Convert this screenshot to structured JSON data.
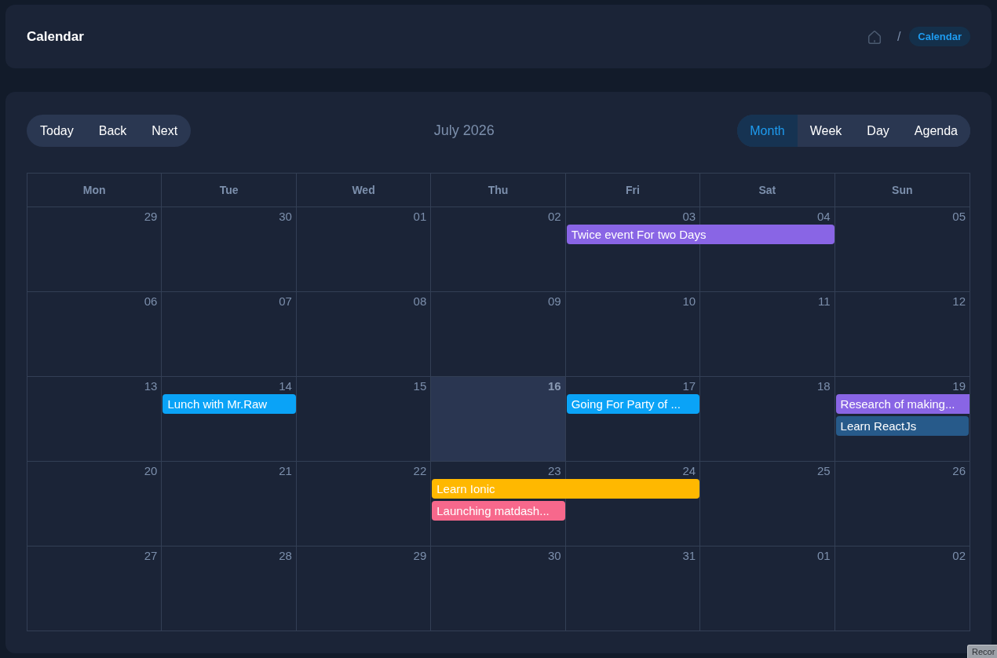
{
  "header": {
    "title": "Calendar",
    "breadcrumb": {
      "separator": "/",
      "current": "Calendar"
    }
  },
  "toolbar": {
    "nav_buttons": [
      "Today",
      "Back",
      "Next"
    ],
    "month_label": "July 2026",
    "views": [
      {
        "label": "Month",
        "selected": true
      },
      {
        "label": "Week",
        "selected": false
      },
      {
        "label": "Day",
        "selected": false
      },
      {
        "label": "Agenda",
        "selected": false
      }
    ]
  },
  "calendar": {
    "weekdays": [
      "Mon",
      "Tue",
      "Wed",
      "Thu",
      "Fri",
      "Sat",
      "Sun"
    ],
    "weeks": [
      {
        "days": [
          {
            "date": "29",
            "today": false
          },
          {
            "date": "30",
            "today": false
          },
          {
            "date": "01",
            "today": false
          },
          {
            "date": "02",
            "today": false
          },
          {
            "date": "03",
            "today": false,
            "events": [
              {
                "title": "Twice event For two Days",
                "color": "#8965e5",
                "continues": true
              }
            ]
          },
          {
            "date": "04",
            "today": false
          },
          {
            "date": "05",
            "today": false
          }
        ]
      },
      {
        "days": [
          {
            "date": "06",
            "today": false
          },
          {
            "date": "07",
            "today": false
          },
          {
            "date": "08",
            "today": false
          },
          {
            "date": "09",
            "today": false
          },
          {
            "date": "10",
            "today": false
          },
          {
            "date": "11",
            "today": false
          },
          {
            "date": "12",
            "today": false
          }
        ]
      },
      {
        "days": [
          {
            "date": "13",
            "today": false
          },
          {
            "date": "14",
            "today": false,
            "events": [
              {
                "title": "Lunch with Mr.Raw",
                "color": "#0aa3f7",
                "continues": false
              }
            ]
          },
          {
            "date": "15",
            "today": false
          },
          {
            "date": "16",
            "today": true
          },
          {
            "date": "17",
            "today": false,
            "events": [
              {
                "title": "Going For Party of ...",
                "color": "#0aa3f7",
                "continues": false
              }
            ]
          },
          {
            "date": "18",
            "today": false
          },
          {
            "date": "19",
            "today": false,
            "events": [
              {
                "title": "Research of making...",
                "color": "#8965e5",
                "continues": true
              },
              {
                "title": "Learn ReactJs",
                "color": "#275a8a",
                "continues": false
              }
            ]
          }
        ]
      },
      {
        "days": [
          {
            "date": "20",
            "today": false
          },
          {
            "date": "21",
            "today": false
          },
          {
            "date": "22",
            "today": false
          },
          {
            "date": "23",
            "today": false,
            "events": [
              {
                "title": "Learn Ionic",
                "color": "#ffb800",
                "continues": true
              },
              {
                "title": "Launching matdash...",
                "color": "#f7688c",
                "continues": false
              }
            ]
          },
          {
            "date": "24",
            "today": false
          },
          {
            "date": "25",
            "today": false
          },
          {
            "date": "26",
            "today": false
          }
        ]
      },
      {
        "days": [
          {
            "date": "27",
            "today": false
          },
          {
            "date": "28",
            "today": false
          },
          {
            "date": "29",
            "today": false
          },
          {
            "date": "30",
            "today": false
          },
          {
            "date": "31",
            "today": false
          },
          {
            "date": "01",
            "today": false
          },
          {
            "date": "02",
            "today": false
          }
        ]
      }
    ]
  },
  "overlay_tab": {
    "label": "Recor"
  }
}
